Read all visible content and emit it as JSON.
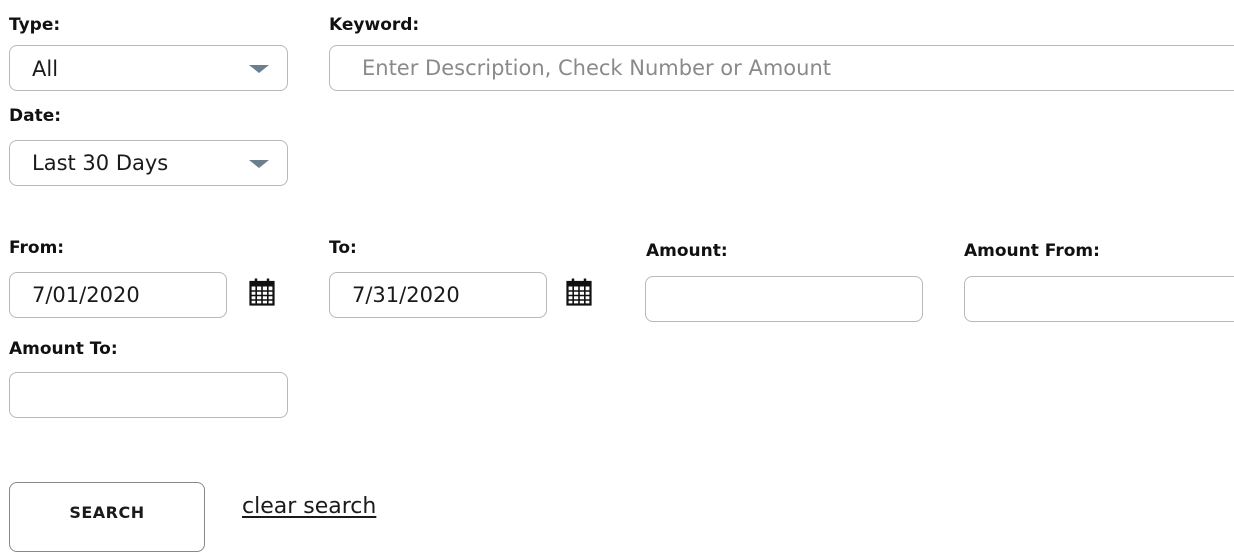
{
  "filters": {
    "type": {
      "label": "Type:",
      "selected": "All"
    },
    "keyword": {
      "label": "Keyword:",
      "placeholder": "Enter Description, Check Number or Amount",
      "value": ""
    },
    "date": {
      "label": "Date:",
      "selected": "Last 30 Days"
    },
    "from": {
      "label": "From:",
      "value": "7/01/2020"
    },
    "to": {
      "label": "To:",
      "value": "7/31/2020"
    },
    "amount": {
      "label": "Amount:",
      "value": ""
    },
    "amount_from": {
      "label": "Amount From:",
      "value": ""
    },
    "amount_to": {
      "label": "Amount To:",
      "value": ""
    }
  },
  "actions": {
    "search_label": "SEARCH",
    "clear_label": "clear search"
  },
  "icons": {
    "dropdown": "chevron-down-icon",
    "calendar": "calendar-icon"
  },
  "colors": {
    "border": "#b8b8b8",
    "caret": "#6c7f8d",
    "placeholder": "#8a8a8a",
    "text": "#111111"
  }
}
